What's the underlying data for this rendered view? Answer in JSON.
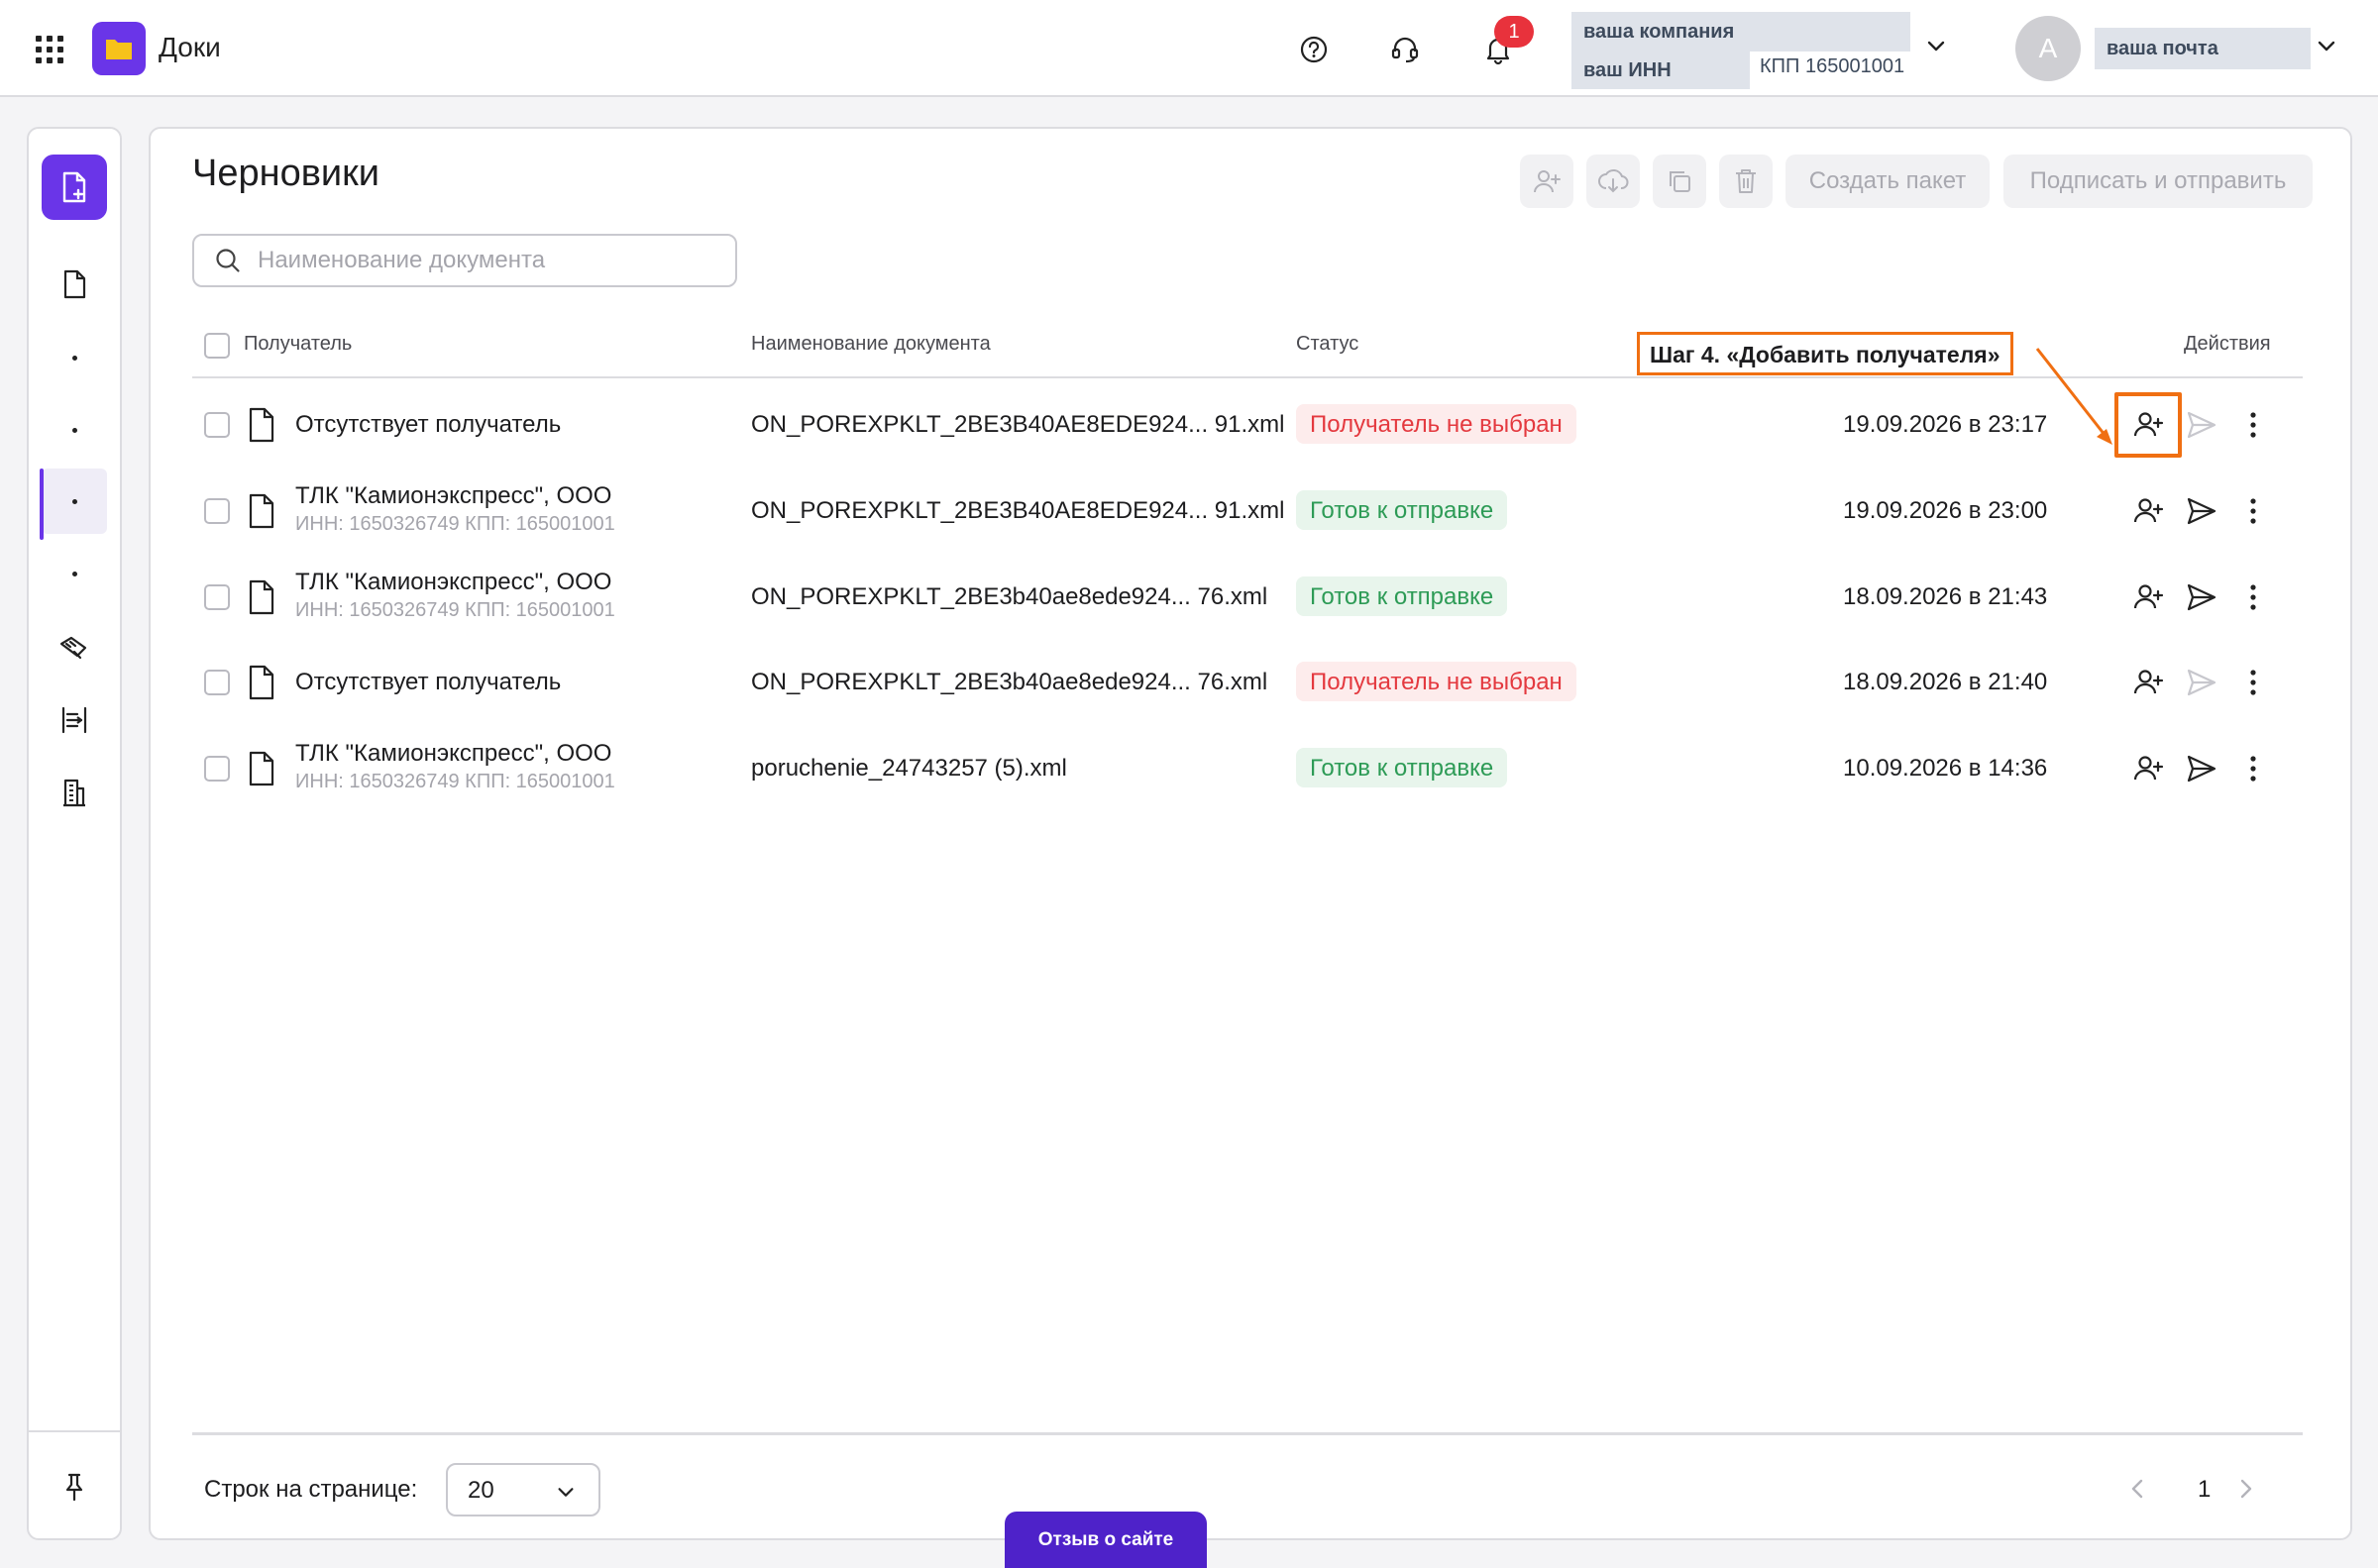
{
  "header": {
    "app_title": "Доки",
    "notifications_count": "1",
    "company_name": "ваша компания",
    "company_inn": "ваш ИНН",
    "company_kpp": "КПП 165001001",
    "avatar_letter": "А",
    "user_email": "ваша почта",
    "icons": [
      "apps-grid-icon",
      "folder-icon",
      "help-icon",
      "support-headset-icon",
      "bell-icon",
      "chevron-down-icon"
    ]
  },
  "sidebar": {
    "items": [
      "create-document",
      "documents",
      "dot",
      "dot",
      "dot-active",
      "dot",
      "signature",
      "exchange",
      "organization",
      "pin"
    ]
  },
  "page": {
    "title": "Черновики",
    "search_placeholder": "Наименование документа",
    "toolbar": {
      "create_package": "Создать пакет",
      "sign_and_send": "Подписать и отправить"
    },
    "columns": {
      "recipient": "Получатель",
      "document": "Наименование документа",
      "status": "Статус",
      "actions": "Действия"
    },
    "rows": [
      {
        "recipient": "Отсутствует получатель",
        "recipient_sub": "",
        "document": "ON_POREXPKLT_2BE3B40AE8EDE924... 91.xml",
        "status": "Получатель не выбран",
        "status_type": "bad",
        "date": "19.09.2026 в 23:17",
        "send_enabled": false
      },
      {
        "recipient": "ТЛК \"Камионэкспресс\", ООО",
        "recipient_sub": "ИНН: 1650326749 КПП: 165001001",
        "document": "ON_POREXPKLT_2BE3B40AE8EDE924... 91.xml",
        "status": "Готов к отправке",
        "status_type": "ok",
        "date": "19.09.2026 в 23:00",
        "send_enabled": true
      },
      {
        "recipient": "ТЛК \"Камионэкспресс\", ООО",
        "recipient_sub": "ИНН: 1650326749 КПП: 165001001",
        "document": "ON_POREXPKLT_2BE3b40ae8ede924... 76.xml",
        "status": "Готов к отправке",
        "status_type": "ok",
        "date": "18.09.2026 в 21:43",
        "send_enabled": true
      },
      {
        "recipient": "Отсутствует получатель",
        "recipient_sub": "",
        "document": "ON_POREXPKLT_2BE3b40ae8ede924... 76.xml",
        "status": "Получатель не выбран",
        "status_type": "bad",
        "date": "18.09.2026 в 21:40",
        "send_enabled": false
      },
      {
        "recipient": "ТЛК \"Камионэкспресс\", ООО",
        "recipient_sub": "ИНН: 1650326749 КПП: 165001001",
        "document": "poruchenie_24743257 (5).xml",
        "status": "Готов к отправке",
        "status_type": "ok",
        "date": "10.09.2026 в 14:36",
        "send_enabled": true
      }
    ],
    "callout": "Шаг 4. «Добавить получателя»",
    "rows_per_page_label": "Строк на странице:",
    "rows_per_page_value": "20",
    "current_page": "1"
  },
  "feedback_button": "Отзыв о сайте",
  "colors": {
    "accent": "#6a35e8",
    "callout": "#f06f12",
    "status_bad": "#e4393f",
    "status_ok": "#2d9b56",
    "badge": "#e8323c"
  }
}
